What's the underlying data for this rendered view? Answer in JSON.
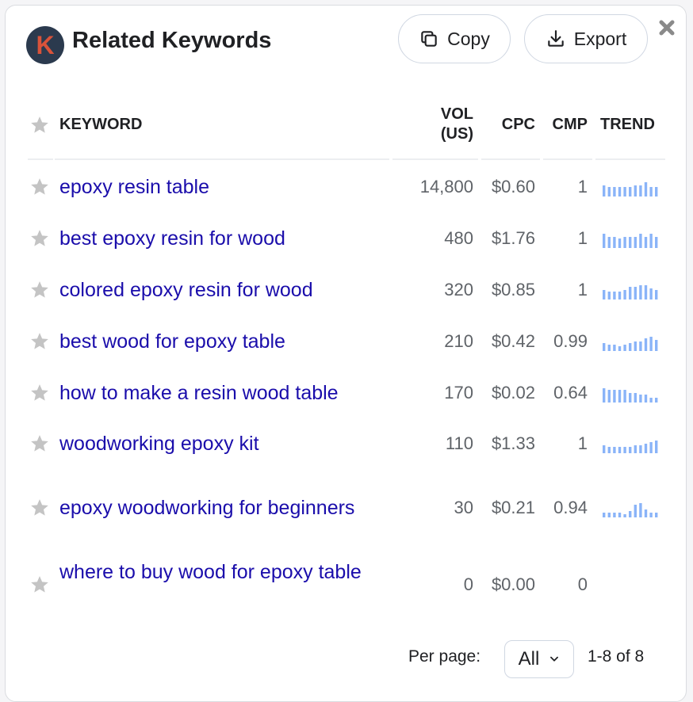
{
  "header": {
    "logo_letter": "K",
    "title": "Related Keywords",
    "copy_label": "Copy",
    "export_label": "Export"
  },
  "table": {
    "columns": {
      "keyword": "KEYWORD",
      "vol_line1": "VOL",
      "vol_line2": "(US)",
      "cpc": "CPC",
      "cmp": "CMP",
      "trend": "TREND"
    },
    "rows": [
      {
        "keyword": "epoxy resin table",
        "vol": "14,800",
        "cpc": "$0.60",
        "cmp": "1",
        "trend": [
          7,
          6,
          6,
          6,
          6,
          6,
          7,
          7,
          9,
          6,
          6
        ]
      },
      {
        "keyword": "best epoxy resin for wood",
        "vol": "480",
        "cpc": "$1.76",
        "cmp": "1",
        "trend": [
          9,
          7,
          7,
          6,
          7,
          7,
          7,
          9,
          7,
          9,
          7
        ]
      },
      {
        "keyword": "colored epoxy resin for wood",
        "vol": "320",
        "cpc": "$0.85",
        "cmp": "1",
        "trend": [
          6,
          5,
          5,
          5,
          6,
          8,
          8,
          9,
          9,
          7,
          6
        ]
      },
      {
        "keyword": "best wood for epoxy table",
        "vol": "210",
        "cpc": "$0.42",
        "cmp": "0.99",
        "trend": [
          5,
          4,
          4,
          3,
          4,
          5,
          6,
          6,
          8,
          9,
          7
        ]
      },
      {
        "keyword": "how to make a resin wood table",
        "vol": "170",
        "cpc": "$0.02",
        "cmp": "0.64",
        "trend": [
          9,
          8,
          8,
          8,
          8,
          6,
          6,
          5,
          5,
          3,
          3
        ]
      },
      {
        "keyword": "woodworking epoxy kit",
        "vol": "110",
        "cpc": "$1.33",
        "cmp": "1",
        "trend": [
          5,
          4,
          4,
          4,
          4,
          4,
          5,
          5,
          6,
          7,
          8
        ]
      },
      {
        "keyword": "epoxy woodworking for beginners",
        "vol": "30",
        "cpc": "$0.21",
        "cmp": "0.94",
        "trend": [
          3,
          3,
          3,
          3,
          2,
          4,
          8,
          9,
          5,
          3,
          3
        ]
      },
      {
        "keyword": "where to buy wood for epoxy table",
        "vol": "0",
        "cpc": "$0.00",
        "cmp": "0",
        "trend": []
      }
    ]
  },
  "footer": {
    "per_page_label": "Per page:",
    "per_page_value": "All",
    "range": "1-8 of 8"
  },
  "colors": {
    "link": "#1a0dab",
    "trend": "#8ab4f8",
    "star": "#c4c4c4"
  },
  "icons": [
    "logo-icon",
    "copy-icon",
    "export-icon",
    "close-icon",
    "star-icon",
    "chevron-down-icon"
  ]
}
